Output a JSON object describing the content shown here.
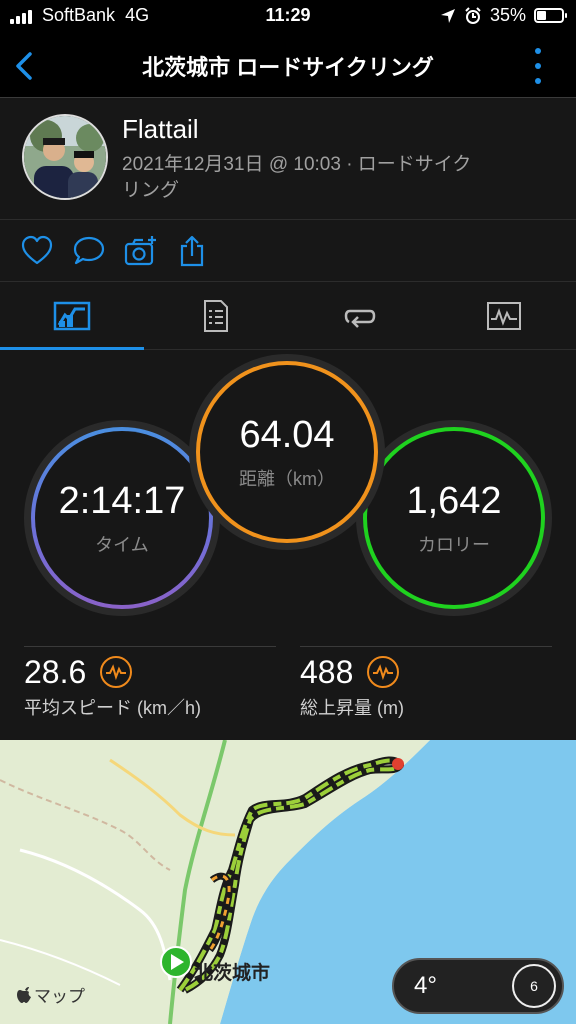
{
  "status_bar": {
    "carrier": "SoftBank",
    "network": "4G",
    "time": "11:29",
    "battery": "35%"
  },
  "nav": {
    "title": "北茨城市 ロードサイクリング"
  },
  "header": {
    "user_name": "Flattail",
    "activity_meta": "2021年12月31日 @ 10:03 · ロードサイクリング"
  },
  "stats": {
    "time": {
      "value": "2:14:17",
      "label": "タイム"
    },
    "distance": {
      "value": "64.04",
      "label": "距離（km）"
    },
    "calories": {
      "value": "1,642",
      "label": "カロリー"
    },
    "avg_speed": {
      "value": "28.6",
      "label": "平均スピード (km／h)"
    },
    "elevation": {
      "value": "488",
      "label": "総上昇量 (m)"
    }
  },
  "map": {
    "place_label": "北茨城市",
    "attribution": "マップ",
    "temperature": "4°",
    "wind_speed": "6"
  },
  "colors": {
    "accent": "#1e90e8",
    "time_ring": "#4a8fe0",
    "distance_ring": "#f0921c",
    "calorie_ring": "#1fd21f"
  }
}
